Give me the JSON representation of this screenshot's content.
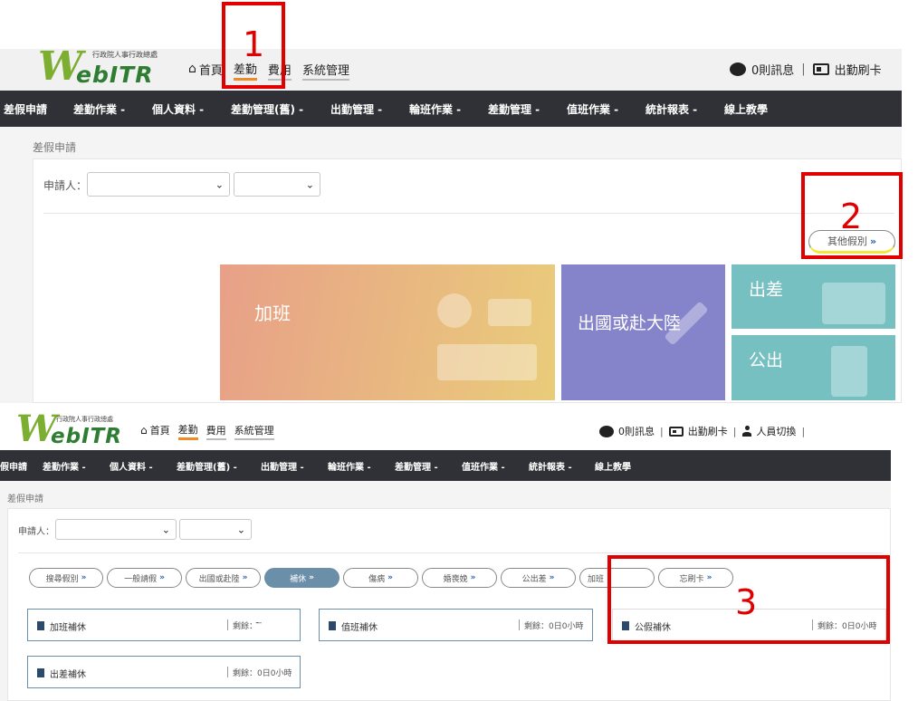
{
  "header": {
    "logo_w": "W",
    "logo_ebitr": "ebITR",
    "logo_org": "行政院人事行政總處",
    "nav": [
      "首頁",
      "差勤",
      "費用",
      "系統管理"
    ],
    "messages": "0則訊息",
    "separator": "|",
    "punch": "出勤刷卡",
    "switch_user": "人員切換"
  },
  "menu_top": [
    "差假申請",
    "差勤作業 -",
    "個人資料 -",
    "差勤管理(舊) -",
    "出勤管理 -",
    "輪班作業 -",
    "差勤管理 -",
    "值班作業 -",
    "統計報表 -",
    "線上教學"
  ],
  "menu_bottom": [
    "假申請",
    "差勤作業 -",
    "個人資料 -",
    "差勤管理(舊) -",
    "出勤管理 -",
    "輪班作業 -",
    "差勤管理 -",
    "值班作業 -",
    "統計報表 -",
    "線上教學"
  ],
  "page": {
    "breadcrumb": "差假申請",
    "applicant_label": "申請人：",
    "other_leave": "其他假別",
    "arrows": "»"
  },
  "tiles": {
    "overtime": "加班",
    "abroad": "出國或赴大陸",
    "business_trip": "出差",
    "official_outing": "公出"
  },
  "pills": [
    "搜尋假別",
    "一般請假",
    "出國或赴陸",
    "補休",
    "傷病",
    "婚喪娩",
    "公出差",
    "加班",
    "忘刷卡"
  ],
  "cards": [
    {
      "name": "加班補休",
      "value": "剩餘：̄ ̄ ̄"
    },
    {
      "name": "值班補休",
      "value": "剩餘：0日0小時"
    },
    {
      "name": "公假補休",
      "value": "剩餘：0日0小時"
    },
    {
      "name": "出差補休",
      "value": "剩餘：0日0小時"
    }
  ],
  "annotations": {
    "one": "1",
    "two": "2",
    "three": "3"
  },
  "colors": {
    "dark_menu": "#2f3136",
    "active_underline": "#f08a24",
    "tile_overtime_from": "#e8a088",
    "tile_overtime_to": "#e9cc7a",
    "tile_abroad": "#8583c9",
    "tile_trip": "#76c0c2",
    "pill_highlight": "#6b8fa8",
    "annotation_red": "#e00000"
  }
}
